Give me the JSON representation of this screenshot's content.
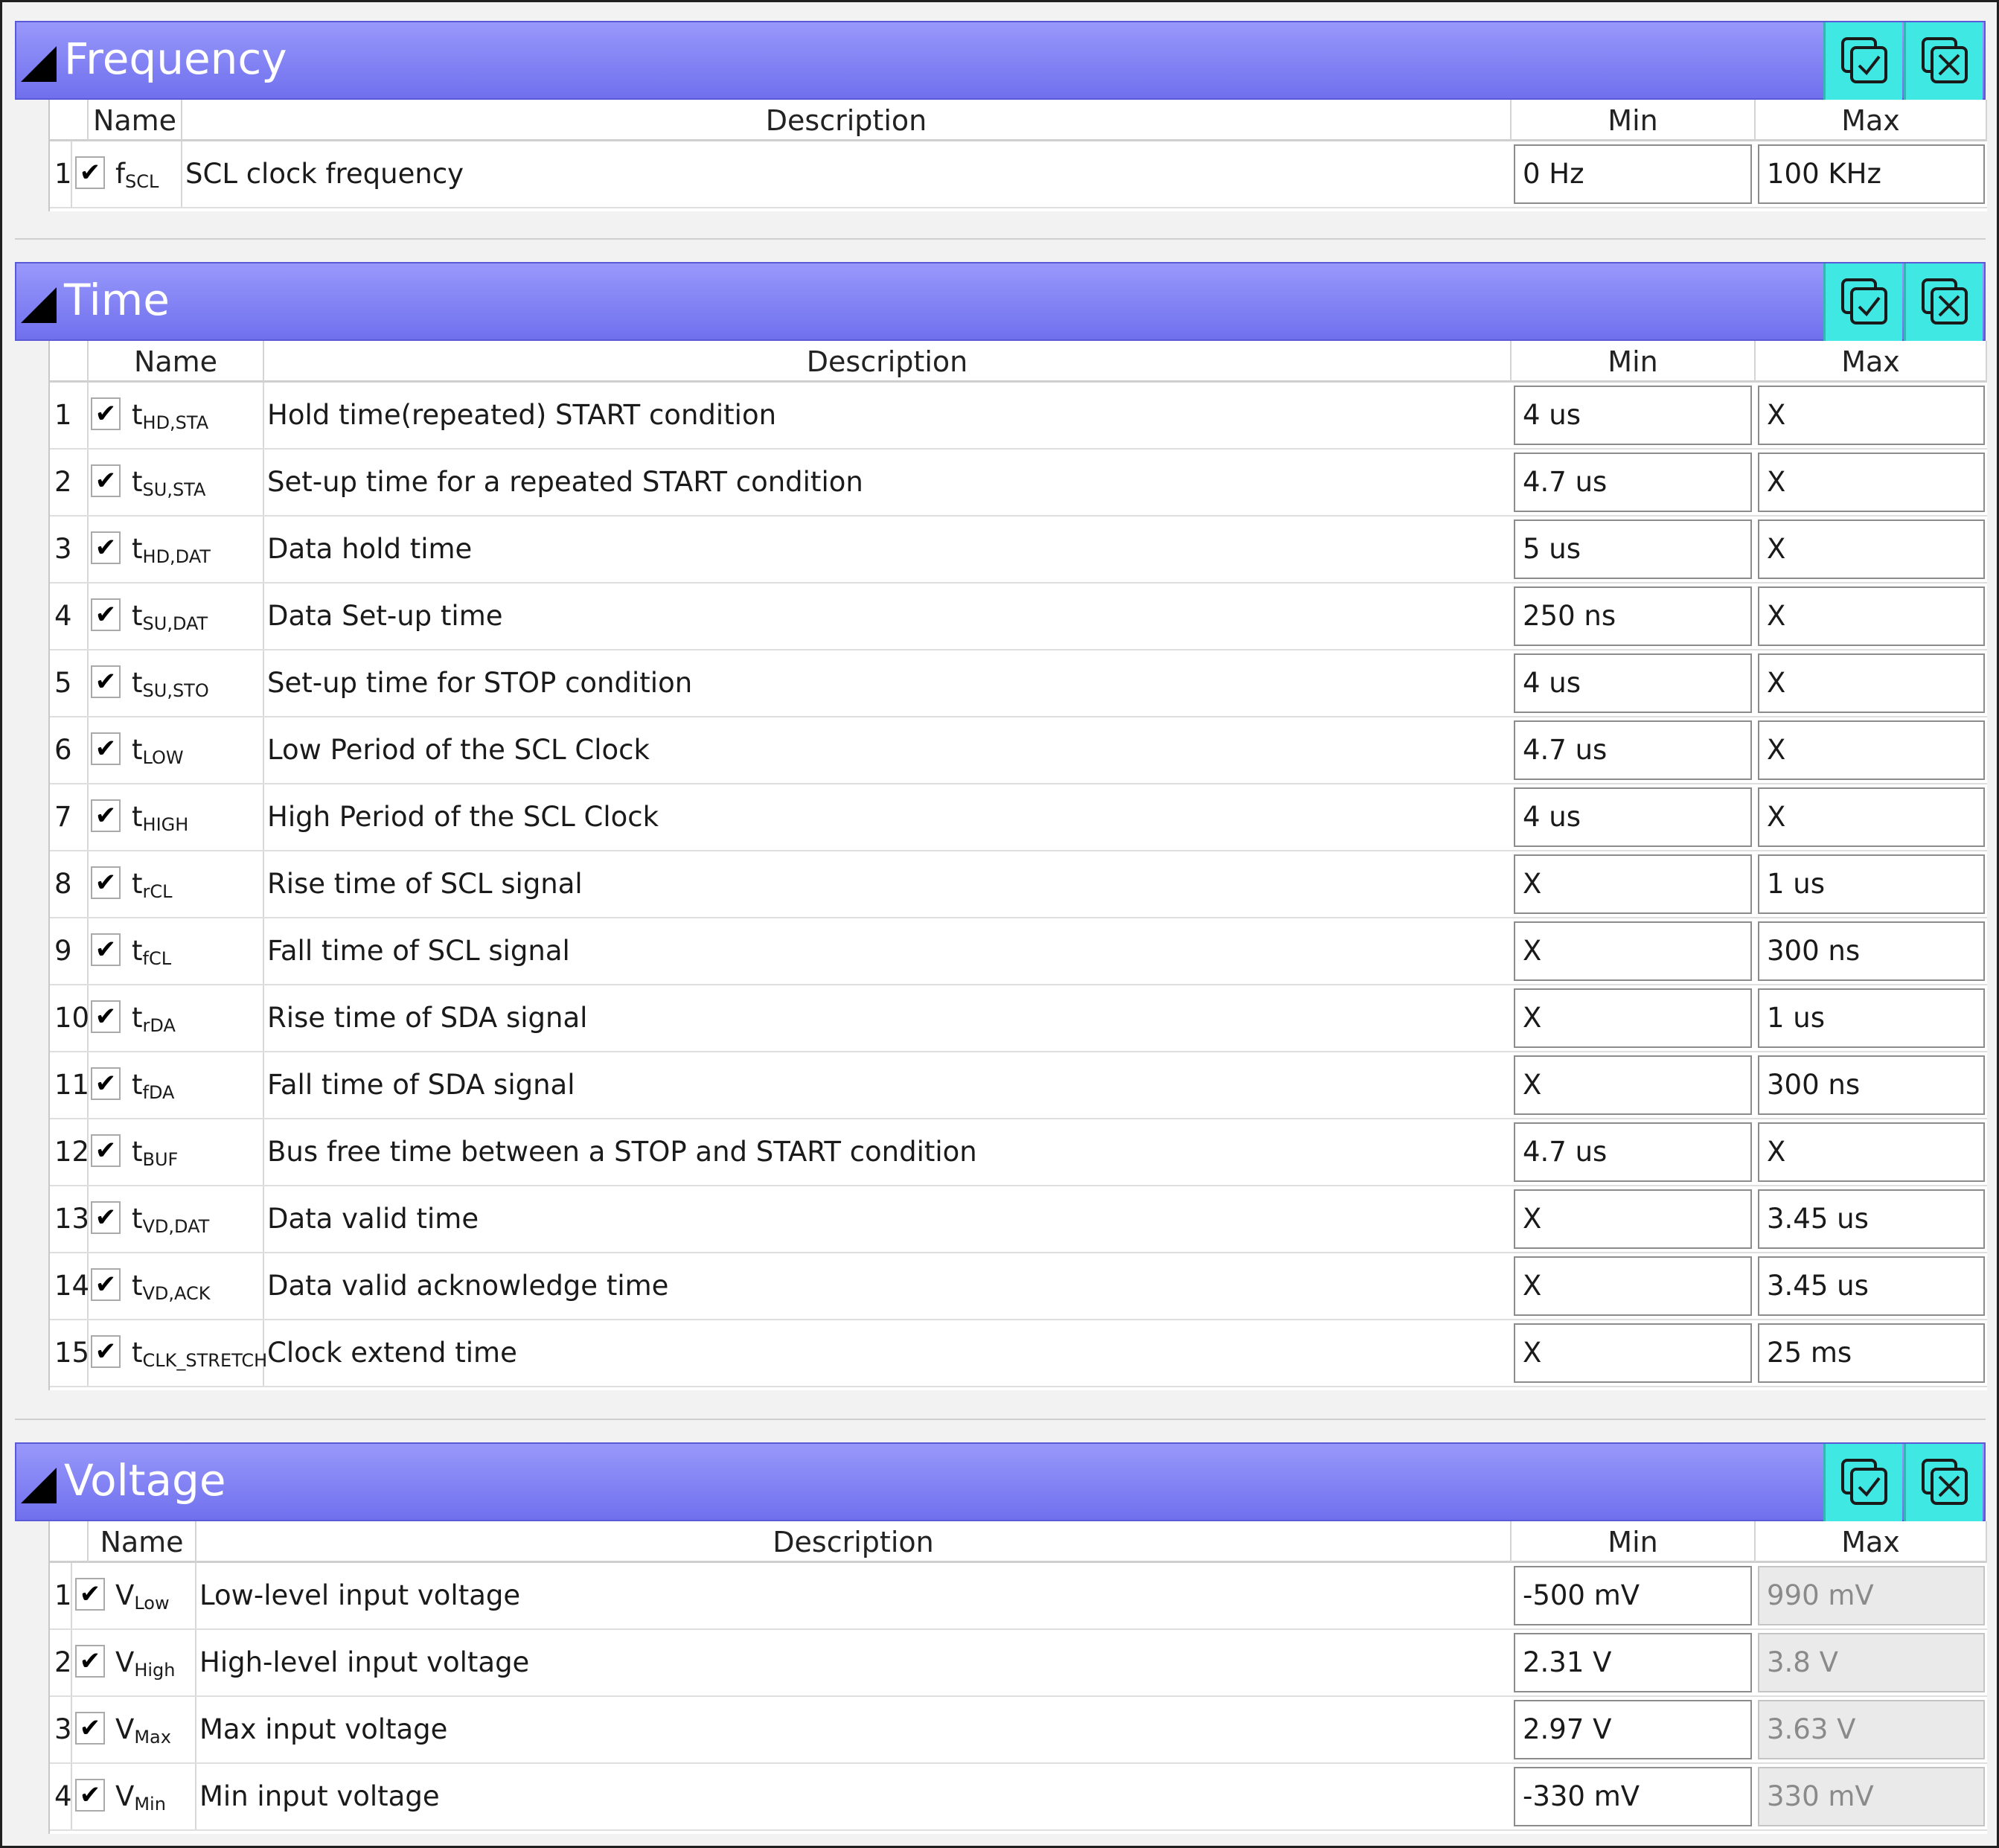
{
  "columns": {
    "name": "Name",
    "description": "Description",
    "min": "Min",
    "max": "Max"
  },
  "header_buttons": {
    "select_all_icon": "check-all-icon",
    "clear_all_icon": "clear-all-icon"
  },
  "colors": {
    "header": "#8080f4",
    "header_button": "#3fe8e2",
    "disabled_text": "#8a8a8a"
  },
  "frequency": {
    "title": "Frequency",
    "rows": [
      {
        "num": "1",
        "checked": true,
        "sym": "f",
        "sub": "SCL",
        "desc": "SCL clock frequency",
        "min": "0 Hz",
        "max": "100 KHz"
      }
    ]
  },
  "time": {
    "title": "Time",
    "rows": [
      {
        "num": "1",
        "checked": true,
        "sym": "t",
        "sub": "HD,STA",
        "desc": "Hold time(repeated) START condition",
        "min": "4 us",
        "max": "X"
      },
      {
        "num": "2",
        "checked": true,
        "sym": "t",
        "sub": "SU,STA",
        "desc": "Set-up time for a repeated START condition",
        "min": "4.7 us",
        "max": "X"
      },
      {
        "num": "3",
        "checked": true,
        "sym": "t",
        "sub": "HD,DAT",
        "desc": "Data hold time",
        "min": "5 us",
        "max": "X"
      },
      {
        "num": "4",
        "checked": true,
        "sym": "t",
        "sub": "SU,DAT",
        "desc": "Data Set-up time",
        "min": "250 ns",
        "max": "X"
      },
      {
        "num": "5",
        "checked": true,
        "sym": "t",
        "sub": "SU,STO",
        "desc": "Set-up time for STOP condition",
        "min": "4 us",
        "max": "X"
      },
      {
        "num": "6",
        "checked": true,
        "sym": "t",
        "sub": "LOW",
        "desc": "Low Period of the SCL Clock",
        "min": "4.7 us",
        "max": "X"
      },
      {
        "num": "7",
        "checked": true,
        "sym": "t",
        "sub": "HIGH",
        "desc": "High Period of the SCL Clock",
        "min": "4 us",
        "max": "X"
      },
      {
        "num": "8",
        "checked": true,
        "sym": "t",
        "sub": "rCL",
        "desc": "Rise time of SCL signal",
        "min": "X",
        "max": "1 us"
      },
      {
        "num": "9",
        "checked": true,
        "sym": "t",
        "sub": "fCL",
        "desc": "Fall time of SCL signal",
        "min": "X",
        "max": "300 ns"
      },
      {
        "num": "10",
        "checked": true,
        "sym": "t",
        "sub": "rDA",
        "desc": "Rise time of SDA signal",
        "min": "X",
        "max": "1 us"
      },
      {
        "num": "11",
        "checked": true,
        "sym": "t",
        "sub": "fDA",
        "desc": "Fall time of SDA signal",
        "min": "X",
        "max": "300 ns"
      },
      {
        "num": "12",
        "checked": true,
        "sym": "t",
        "sub": "BUF",
        "desc": "Bus free time between a STOP and START condition",
        "min": "4.7 us",
        "max": "X"
      },
      {
        "num": "13",
        "checked": true,
        "sym": "t",
        "sub": "VD,DAT",
        "desc": "Data valid time",
        "min": "X",
        "max": "3.45 us"
      },
      {
        "num": "14",
        "checked": true,
        "sym": "t",
        "sub": "VD,ACK",
        "desc": "Data valid acknowledge time",
        "min": "X",
        "max": "3.45 us"
      },
      {
        "num": "15",
        "checked": true,
        "sym": "t",
        "sub": "CLK_STRETCH",
        "desc": "Clock extend time",
        "min": "X",
        "max": "25 ms"
      }
    ]
  },
  "voltage": {
    "title": "Voltage",
    "rows": [
      {
        "num": "1",
        "checked": true,
        "sym": "V",
        "sub": "Low",
        "desc": "Low-level input voltage",
        "min": "-500 mV",
        "max": "990 mV",
        "max_disabled": true
      },
      {
        "num": "2",
        "checked": true,
        "sym": "V",
        "sub": "High",
        "desc": "High-level input voltage",
        "min": "2.31 V",
        "max": "3.8 V",
        "max_disabled": true
      },
      {
        "num": "3",
        "checked": true,
        "sym": "V",
        "sub": "Max",
        "desc": "Max input voltage",
        "min": "2.97 V",
        "max": "3.63 V",
        "max_disabled": true
      },
      {
        "num": "4",
        "checked": true,
        "sym": "V",
        "sub": "Min",
        "desc": "Min input voltage",
        "min": "-330 mV",
        "max": "330 mV",
        "max_disabled": true
      }
    ]
  }
}
